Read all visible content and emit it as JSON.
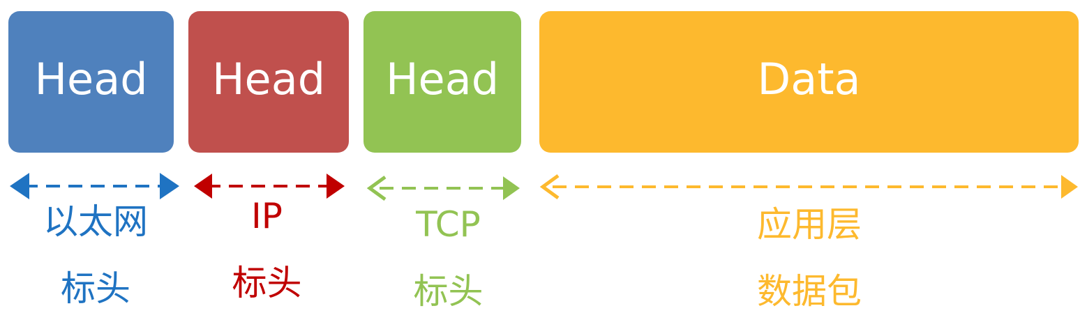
{
  "segments": [
    {
      "block_text": "Head",
      "line1": "以太网",
      "line2": "标头",
      "color": "#4F81BD",
      "label_color": "#1F73C2"
    },
    {
      "block_text": "Head",
      "line1": "IP",
      "line2": "标头",
      "color": "#C0504D",
      "label_color": "#C00000"
    },
    {
      "block_text": "Head",
      "line1": "TCP",
      "line2": "标头",
      "color": "#92C353",
      "label_color": "#92C353"
    },
    {
      "block_text": "Data",
      "line1": "应用层",
      "line2": "数据包",
      "color": "#FDB92E",
      "label_color": "#FDB92E"
    }
  ]
}
